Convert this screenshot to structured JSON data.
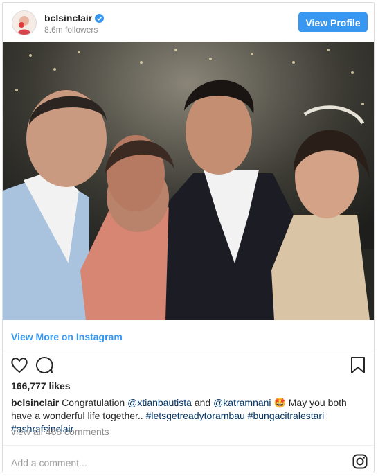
{
  "header": {
    "username": "bclsinclair",
    "followers": "8.6m followers",
    "view_profile_label": "View Profile"
  },
  "photo": {
    "description_icon": "group-photo"
  },
  "links": {
    "view_more_label": "View More on Instagram"
  },
  "actions": {
    "like_icon": "heart-icon",
    "comment_icon": "comment-icon",
    "save_icon": "bookmark-icon"
  },
  "likes": "166,777 likes",
  "caption": {
    "username": "bclsinclair",
    "text_1": "Congratulation",
    "mention_1": "@xtianbautista",
    "text_2": "and",
    "mention_2": "@katramnani",
    "emoji": "🤩",
    "text_3": "May you both have a wonderful life together..",
    "hashtag_1": "#letsgetreadytorambau",
    "hashtag_2": "#bungacitralestari",
    "hashtag_3": "#ashrafsinclair"
  },
  "comments_label": "view all 488 comments",
  "comment_input": {
    "placeholder": "Add a comment..."
  },
  "colors": {
    "accent": "#3897f0",
    "link": "#003569",
    "muted": "#8e8e8e"
  }
}
